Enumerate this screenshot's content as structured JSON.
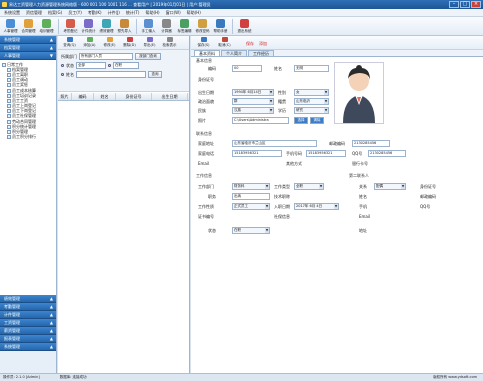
{
  "window": {
    "title": "易达工资管理人力资源管理系统网络版 - 600 001 100 1001 116 ... 查看用户 | 2019年01月01日 | 用户:管理员"
  },
  "menu": [
    "系统设置",
    "资信管理",
    "档案(G)",
    "员工(Y)",
    "考勤(K)",
    "计件(J)",
    "统计(T)",
    "帮助(H)",
    "窗口(W)",
    "帮助(H)"
  ],
  "toolbar": [
    {
      "label": "人事管理",
      "color": "#4a8ed6"
    },
    {
      "label": "合同管理",
      "color": "#e0a13a"
    },
    {
      "label": "培训管理",
      "color": "#5fb05a"
    },
    {
      "label": "考勤登记",
      "color": "#d65b4a"
    },
    {
      "label": "计件统计",
      "color": "#7a6cc8"
    },
    {
      "label": "绩效管理",
      "color": "#3fa6b8"
    },
    {
      "label": "预先导入",
      "color": "#c88a3a"
    },
    {
      "label": "手工输入",
      "color": "#5a8fd0"
    },
    {
      "label": "计算器",
      "color": "#888888"
    },
    {
      "label": "标签编辑",
      "color": "#4aa060"
    },
    {
      "label": "修改密码",
      "color": "#d0a040"
    },
    {
      "label": "帮助手册",
      "color": "#3a78c0"
    },
    {
      "label": "退出系统",
      "color": "#d04040"
    }
  ],
  "left": {
    "top_headers": [
      "系统管理",
      "档案管理",
      "人事管理"
    ],
    "tree_root": "日常工作",
    "tree": [
      "档案管理",
      "员工离职",
      "员工调动",
      "员工奖惩",
      "员工成本核算",
      "员工培训记录",
      "员工工资",
      "员工上岗登记",
      "员工下岗登记",
      "员工社保管理",
      "劳动合同管理",
      "积分统计管理",
      "积分管理",
      "员工积分排行"
    ],
    "bottom_headers": [
      "绩效管理",
      "考勤管理",
      "计件管理",
      "工资管理",
      "薪资管理",
      "报表管理",
      "系统管理"
    ]
  },
  "list": {
    "toolbar": [
      "查询(Q)",
      "添加(A)",
      "修改(E)",
      "删除(D)",
      "导出(E)",
      "检索表示"
    ],
    "filter_label1": "所属部门",
    "filter_value1": "所有部门人员",
    "filter_btn": "按部门查询",
    "filter_label2": "状态",
    "filter_value2": "全部",
    "filter_value3": "在职",
    "filter_label3": "姓名",
    "query_btn": "查询",
    "columns": [
      "照片",
      "编码",
      "姓名",
      "身份证号",
      "出生日期"
    ]
  },
  "detail": {
    "toolbar": [
      "保存(S)",
      "取消(C)"
    ],
    "toolbar_red": [
      "保存",
      "添加"
    ],
    "tabs": [
      "基本资料",
      "个人简介",
      "工作经历"
    ],
    "sec_basic": "基本信息",
    "f": {
      "code_l": "编码",
      "code_v": "00",
      "name_l": "姓名",
      "name_v": "无明",
      "id_l": "身份证号",
      "birth_l": "出生日期",
      "birth_v": "1994年 6月14日",
      "gender_l": "性别",
      "gender_v": "女",
      "pol_l": "政治面貌",
      "pol_v": "群",
      "nat_l": "籍贯",
      "nat_v": "山东临沂",
      "eth_l": "民族",
      "eth_v": "汉族",
      "edu_l": "学历",
      "edu_v": "研究",
      "photo_l": "照片",
      "photo_v": "C:\\Users\\Administra",
      "btn_select": "选择",
      "btn_clear": "清除"
    },
    "sec_contact": "联系信息",
    "c": {
      "addr_l": "家庭地址",
      "addr_v": "山东省临沂市兰山区",
      "post_l": "邮政编码",
      "post_v": "2130285456",
      "home_l": "家庭电话",
      "home_v": "15183956321",
      "mob_l": "手机号码",
      "mob_v": "15183956321",
      "qq_l": "QQ号",
      "qq_v": "2130285456",
      "email_l": "Email",
      "other_l": "其他方式",
      "bank_l": "银行卡号"
    },
    "sec_work": "工作信息",
    "w": {
      "dept_l": "工作部门",
      "dept_v": "财务科",
      "type_l": "工作类型",
      "type_v": "全职",
      "pos_l": "职务",
      "pos_v": "出纳",
      "title_l": "技术职称",
      "nature_l": "工作性质",
      "nature_v": "正式员工",
      "date_l": "入职日期",
      "date_v": "2017年 6月 4日",
      "cert_l": "证书编号",
      "social_l": "社保信息",
      "state_l": "状态",
      "state_v": "在职"
    },
    "sec_emerg": "第二联系人",
    "e": {
      "rel_l": "关系",
      "rel_v": "配偶",
      "name_l": "姓名",
      "id_l": "身份证号",
      "post_l": "邮政编码",
      "addr_l": "地址",
      "mob_l": "手机",
      "qq_l": "QQ号",
      "email_l": "Email",
      "addr2_l": "地址"
    }
  },
  "status": [
    "操作员: 2.1.0 [Admin]",
    "数据库: 连接成功",
    "版权所有 www.ydsoft.com"
  ]
}
